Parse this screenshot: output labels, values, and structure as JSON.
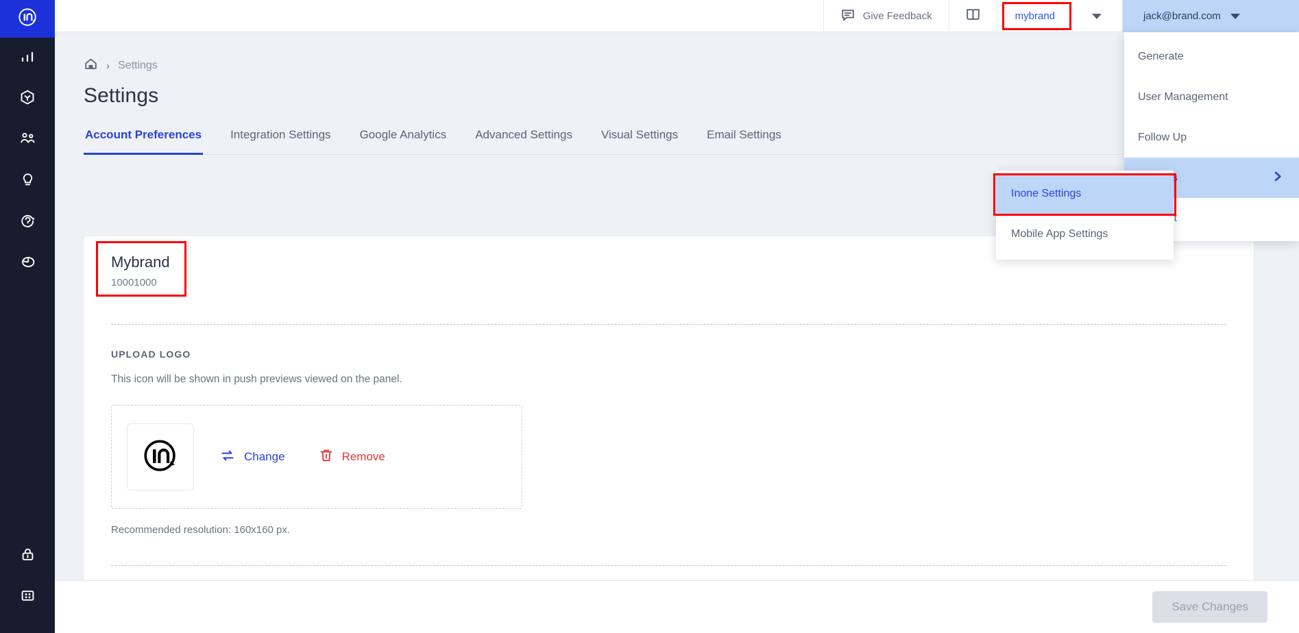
{
  "sidebar": {
    "logo_icon": "in-logo-icon",
    "items": [
      {
        "icon": "bar-chart-icon",
        "name": "analytics"
      },
      {
        "icon": "hexagon-target-icon",
        "name": "campaigns"
      },
      {
        "icon": "audience-people-icon",
        "name": "audience"
      },
      {
        "icon": "lightbulb-icon",
        "name": "insights"
      },
      {
        "icon": "circle-arrow-icon",
        "name": "automation"
      },
      {
        "icon": "pie-chart-icon",
        "name": "reports"
      }
    ],
    "bottom_items": [
      {
        "icon": "lock-icon",
        "name": "security"
      },
      {
        "icon": "grid-apps-icon",
        "name": "apps"
      }
    ]
  },
  "topbar": {
    "feedback_label": "Give Feedback",
    "feedback_icon": "chat-bubble-icon",
    "book_icon": "book-icon",
    "brand_label": "mybrand",
    "brand_caret_icon": "chevron-down-icon",
    "user_email": "jack@brand.com",
    "user_caret_icon": "chevron-down-icon"
  },
  "breadcrumb": {
    "home_icon": "home-icon",
    "separator": "›",
    "current": "Settings"
  },
  "page": {
    "title": "Settings"
  },
  "tabs": [
    {
      "label": "Account Preferences",
      "active": true
    },
    {
      "label": "Integration Settings",
      "active": false
    },
    {
      "label": "Google Analytics",
      "active": false
    },
    {
      "label": "Advanced Settings",
      "active": false
    },
    {
      "label": "Visual Settings",
      "active": false
    },
    {
      "label": "Email Settings",
      "active": false
    }
  ],
  "account": {
    "brand_name": "Mybrand",
    "brand_id": "10001000"
  },
  "upload_logo": {
    "section_label": "UPLOAD LOGO",
    "description": "This icon will be shown in push previews viewed on the panel.",
    "logo_icon": "in-logo-icon",
    "change_label": "Change",
    "change_icon": "swap-arrows-icon",
    "remove_label": "Remove",
    "remove_icon": "trash-icon",
    "recommendation": "Recommended resolution: 160x160 px."
  },
  "footer": {
    "save_label": "Save Changes"
  },
  "user_menu": {
    "items": [
      {
        "label": "Generate",
        "active": false,
        "has_submenu": false
      },
      {
        "label": "User Management",
        "active": false,
        "has_submenu": false
      },
      {
        "label": "Follow Up",
        "active": false,
        "has_submenu": false
      },
      {
        "label": "Settings",
        "active": true,
        "has_submenu": true,
        "chevron": "›"
      },
      {
        "label": "Log Out",
        "active": false,
        "has_submenu": false
      }
    ]
  },
  "settings_submenu": {
    "items": [
      {
        "label": "Inone Settings",
        "active": true
      },
      {
        "label": "Mobile App Settings",
        "active": false
      }
    ]
  },
  "colors": {
    "accent_blue": "#2b42d6",
    "highlight_red": "#ff0000",
    "menu_highlight": "#bdd6f7",
    "sidebar_dark": "#151d2e",
    "sidebar_logo_blue": "#1a32d8",
    "danger_red": "#e5383b",
    "page_bg": "#eef1f5"
  }
}
